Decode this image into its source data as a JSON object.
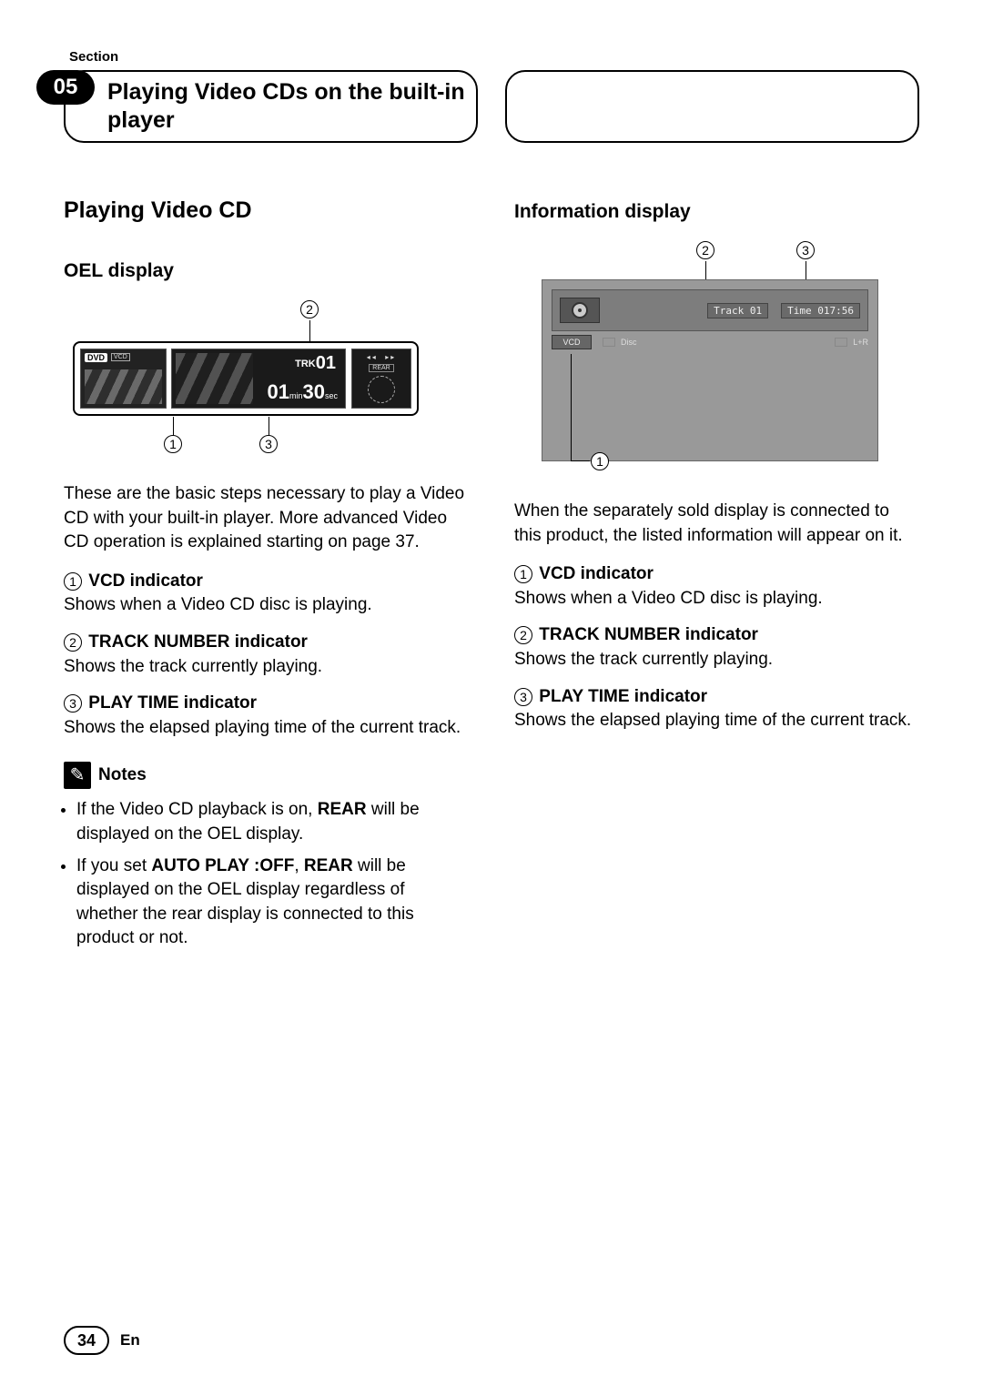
{
  "section_label": "Section",
  "section_number": "05",
  "header_title": "Playing Video CDs on the built-in player",
  "left": {
    "title": "Playing Video CD",
    "subhead": "OEL display",
    "oel": {
      "dvd": "DVD",
      "vcd_tag": "VCD",
      "trk_label": "TRK",
      "trk_num": "01",
      "time_min": "01",
      "time_min_unit": "min",
      "time_sec": "30",
      "time_sec_unit": "sec",
      "rear": "REAR",
      "prev_icon": "◂◂",
      "next_icon": "▸▸"
    },
    "intro": "These are the basic steps necessary to play a Video CD with your built-in player. More advanced Video CD operation is explained starting on page 37.",
    "indicators": [
      {
        "num": "1",
        "title": "VCD indicator",
        "desc": "Shows when a Video CD disc is playing."
      },
      {
        "num": "2",
        "title": "TRACK NUMBER indicator",
        "desc": "Shows the track currently playing."
      },
      {
        "num": "3",
        "title": "PLAY TIME indicator",
        "desc": "Shows the elapsed playing time of the current track."
      }
    ],
    "notes_label": "Notes",
    "notes": [
      {
        "pre": "If the Video CD playback is on, ",
        "b1": "REAR",
        "post": " will be displayed on the OEL display."
      },
      {
        "pre": "If you set ",
        "b1": "AUTO PLAY :OFF",
        "mid": ", ",
        "b2": "REAR",
        "post": " will be displayed on the OEL display regardless of whether the rear display is connected to this product or not."
      }
    ]
  },
  "right": {
    "subhead": "Information display",
    "info": {
      "vcd_box": "VCD",
      "track_field": "Track 01",
      "time_field": "Time 017:56",
      "disc_label": "Disc",
      "lr_label": "L+R"
    },
    "intro": "When the separately sold display is connected to this product, the listed information will appear on it.",
    "indicators": [
      {
        "num": "1",
        "title": "VCD indicator",
        "desc": "Shows when a Video CD disc is playing."
      },
      {
        "num": "2",
        "title": "TRACK NUMBER indicator",
        "desc": "Shows the track currently playing."
      },
      {
        "num": "3",
        "title": "PLAY TIME indicator",
        "desc": "Shows the elapsed playing time of the current track."
      }
    ]
  },
  "footer": {
    "page": "34",
    "lang": "En"
  }
}
